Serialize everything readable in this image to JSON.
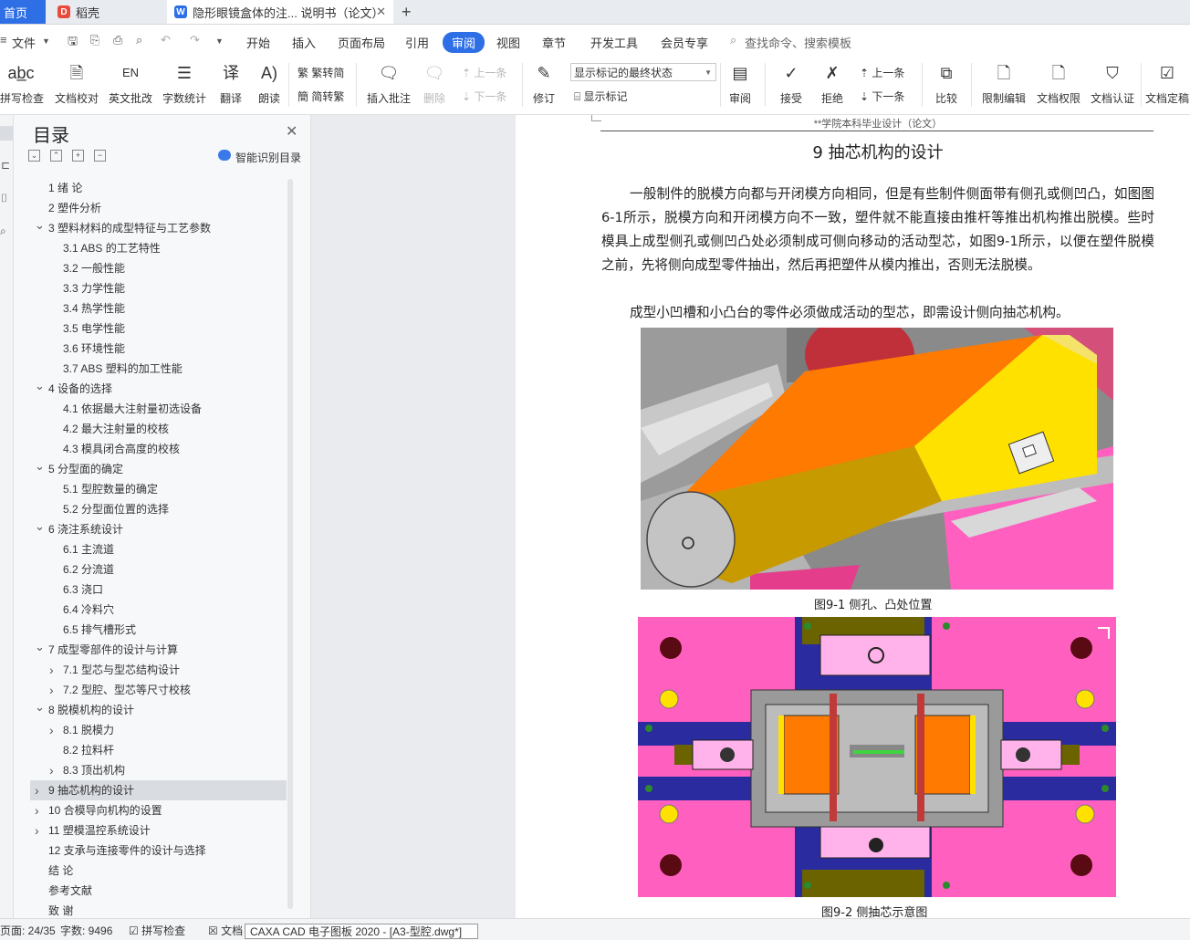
{
  "tabs": {
    "home": "首页",
    "daoke": "稻壳",
    "doc": "隐形眼镜盒体的注... 说明书（论文）",
    "new_tab": "+"
  },
  "menu": {
    "file": "文件",
    "items": [
      "开始",
      "插入",
      "页面布局",
      "引用",
      "审阅",
      "视图",
      "章节",
      "开发工具",
      "会员专享"
    ],
    "active": "审阅",
    "search": "查找命令、搜索模板"
  },
  "ribbon": {
    "spell": "拼写检查",
    "proof": "文档校对",
    "en_proof": "英文批改",
    "wordcount": "字数统计",
    "translate": "翻译",
    "read": "朗读",
    "trad": "繁转简",
    "simp": "简转繁",
    "insert_comment": "插入批注",
    "delete": "删除",
    "prev1": "上一条",
    "next1": "下一条",
    "revise": "修订",
    "mark_state": "显示标记的最终状态",
    "show_marks": "显示标记",
    "review": "审阅",
    "accept": "接受",
    "reject": "拒绝",
    "prev2": "上一条",
    "next2": "下一条",
    "compare": "比较",
    "restrict": "限制编辑",
    "rights": "文档权限",
    "certify": "文档认证",
    "finalize": "文档定稿"
  },
  "nav": {
    "title": "目录",
    "smart": "智能识别目录",
    "toc": [
      {
        "label": "1  绪  论",
        "level": 1,
        "arrow": ""
      },
      {
        "label": "2  塑件分析",
        "level": 1,
        "arrow": ""
      },
      {
        "label": "3  塑料材料的成型特征与工艺参数",
        "level": 1,
        "arrow": "v"
      },
      {
        "label": "3.1  ABS 的工艺特性",
        "level": 2,
        "arrow": ""
      },
      {
        "label": "3.2  一般性能",
        "level": 2,
        "arrow": ""
      },
      {
        "label": "3.3  力学性能",
        "level": 2,
        "arrow": ""
      },
      {
        "label": "3.4  热学性能",
        "level": 2,
        "arrow": ""
      },
      {
        "label": "3.5  电学性能",
        "level": 2,
        "arrow": ""
      },
      {
        "label": "3.6  环境性能",
        "level": 2,
        "arrow": ""
      },
      {
        "label": "3.7 ABS 塑料的加工性能",
        "level": 2,
        "arrow": ""
      },
      {
        "label": "4  设备的选择",
        "level": 1,
        "arrow": "v"
      },
      {
        "label": "4.1  依据最大注射量初选设备",
        "level": 2,
        "arrow": ""
      },
      {
        "label": "4.2  最大注射量的校核",
        "level": 2,
        "arrow": ""
      },
      {
        "label": "4.3  模具闭合高度的校核",
        "level": 2,
        "arrow": ""
      },
      {
        "label": "5  分型面的确定",
        "level": 1,
        "arrow": "v"
      },
      {
        "label": "5.1  型腔数量的确定",
        "level": 2,
        "arrow": ""
      },
      {
        "label": "5.2  分型面位置的选择",
        "level": 2,
        "arrow": ""
      },
      {
        "label": "6  浇注系统设计",
        "level": 1,
        "arrow": "v"
      },
      {
        "label": "6.1  主流道",
        "level": 2,
        "arrow": ""
      },
      {
        "label": "6.2  分流道",
        "level": 2,
        "arrow": ""
      },
      {
        "label": "6.3  浇口",
        "level": 2,
        "arrow": ""
      },
      {
        "label": "6.4  冷料穴",
        "level": 2,
        "arrow": ""
      },
      {
        "label": "6.5  排气槽形式",
        "level": 2,
        "arrow": ""
      },
      {
        "label": "7  成型零部件的设计与计算",
        "level": 1,
        "arrow": "v"
      },
      {
        "label": "7.1  型芯与型芯结构设计",
        "level": 2,
        "arrow": ">"
      },
      {
        "label": "7.2  型腔、型芯等尺寸校核",
        "level": 2,
        "arrow": ">"
      },
      {
        "label": "8  脱模机构的设计",
        "level": 1,
        "arrow": "v"
      },
      {
        "label": "8.1  脱模力",
        "level": 2,
        "arrow": ">"
      },
      {
        "label": "8.2  拉料杆",
        "level": 2,
        "arrow": ""
      },
      {
        "label": "8.3  顶出机构",
        "level": 2,
        "arrow": ">"
      },
      {
        "label": "9  抽芯机构的设计",
        "level": 1,
        "arrow": ">"
      },
      {
        "label": "10  合模导向机构的设置",
        "level": 1,
        "arrow": ">"
      },
      {
        "label": "11  塑模温控系统设计",
        "level": 1,
        "arrow": ">"
      },
      {
        "label": "12  支承与连接零件的设计与选择",
        "level": 1,
        "arrow": ""
      },
      {
        "label": "结  论",
        "level": 1,
        "arrow": ""
      },
      {
        "label": "参考文献",
        "level": 1,
        "arrow": ""
      },
      {
        "label": "致  谢",
        "level": 1,
        "arrow": ""
      }
    ],
    "selected_index": 30
  },
  "doc": {
    "header": "**学院本科毕业设计（论文）",
    "chapter_title": "9  抽芯机构的设计",
    "para1": "一般制件的脱模方向都与开闭模方向相同，但是有些制件侧面带有侧孔或侧凹凸，如图图6-1所示，脱模方向和开闭模方向不一致，塑件就不能直接由推杆等推出机构推出脱模。些时模具上成型侧孔或侧凹凸处必须制成可侧向移动的活动型芯，如图9-1所示，以便在塑件脱模之前，先将侧向成型零件抽出，然后再把塑件从模内推出，否则无法脱模。",
    "para2": "成型小凹槽和小凸台的零件必须做成活动的型芯，即需设计侧向抽芯机构。",
    "fig1_caption": "图9-1  侧孔、凸处位置",
    "fig2_caption": "图9-2  侧抽芯示意图"
  },
  "status": {
    "page": "页面: 24/35",
    "words": "字数: 9496",
    "spell": "拼写检查",
    "doc": "文档",
    "tooltip": "CAXA CAD 电子图板 2020 - [A3-型腔.dwg*]"
  },
  "colors": {
    "accent": "#2f6fe6",
    "orange": "#ff7a00",
    "yellow": "#ffe100",
    "magenta": "#ff5fbf",
    "navy": "#2b2ba0"
  }
}
